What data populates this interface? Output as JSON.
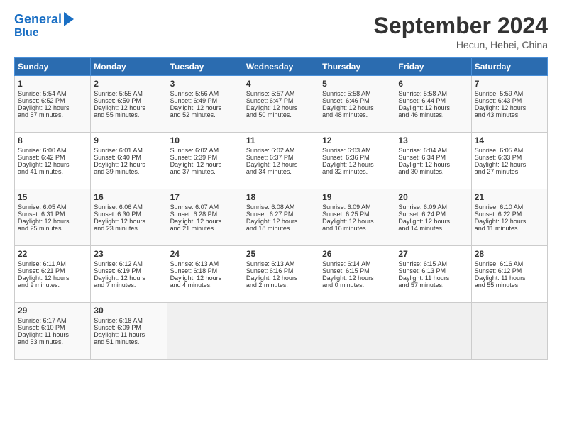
{
  "header": {
    "logo_line1": "General",
    "logo_line2": "Blue",
    "month": "September 2024",
    "location": "Hecun, Hebei, China"
  },
  "days_of_week": [
    "Sunday",
    "Monday",
    "Tuesday",
    "Wednesday",
    "Thursday",
    "Friday",
    "Saturday"
  ],
  "weeks": [
    [
      {
        "day": "1",
        "info": "Sunrise: 5:54 AM\nSunset: 6:52 PM\nDaylight: 12 hours\nand 57 minutes."
      },
      {
        "day": "2",
        "info": "Sunrise: 5:55 AM\nSunset: 6:50 PM\nDaylight: 12 hours\nand 55 minutes."
      },
      {
        "day": "3",
        "info": "Sunrise: 5:56 AM\nSunset: 6:49 PM\nDaylight: 12 hours\nand 52 minutes."
      },
      {
        "day": "4",
        "info": "Sunrise: 5:57 AM\nSunset: 6:47 PM\nDaylight: 12 hours\nand 50 minutes."
      },
      {
        "day": "5",
        "info": "Sunrise: 5:58 AM\nSunset: 6:46 PM\nDaylight: 12 hours\nand 48 minutes."
      },
      {
        "day": "6",
        "info": "Sunrise: 5:58 AM\nSunset: 6:44 PM\nDaylight: 12 hours\nand 46 minutes."
      },
      {
        "day": "7",
        "info": "Sunrise: 5:59 AM\nSunset: 6:43 PM\nDaylight: 12 hours\nand 43 minutes."
      }
    ],
    [
      {
        "day": "8",
        "info": "Sunrise: 6:00 AM\nSunset: 6:42 PM\nDaylight: 12 hours\nand 41 minutes."
      },
      {
        "day": "9",
        "info": "Sunrise: 6:01 AM\nSunset: 6:40 PM\nDaylight: 12 hours\nand 39 minutes."
      },
      {
        "day": "10",
        "info": "Sunrise: 6:02 AM\nSunset: 6:39 PM\nDaylight: 12 hours\nand 37 minutes."
      },
      {
        "day": "11",
        "info": "Sunrise: 6:02 AM\nSunset: 6:37 PM\nDaylight: 12 hours\nand 34 minutes."
      },
      {
        "day": "12",
        "info": "Sunrise: 6:03 AM\nSunset: 6:36 PM\nDaylight: 12 hours\nand 32 minutes."
      },
      {
        "day": "13",
        "info": "Sunrise: 6:04 AM\nSunset: 6:34 PM\nDaylight: 12 hours\nand 30 minutes."
      },
      {
        "day": "14",
        "info": "Sunrise: 6:05 AM\nSunset: 6:33 PM\nDaylight: 12 hours\nand 27 minutes."
      }
    ],
    [
      {
        "day": "15",
        "info": "Sunrise: 6:05 AM\nSunset: 6:31 PM\nDaylight: 12 hours\nand 25 minutes."
      },
      {
        "day": "16",
        "info": "Sunrise: 6:06 AM\nSunset: 6:30 PM\nDaylight: 12 hours\nand 23 minutes."
      },
      {
        "day": "17",
        "info": "Sunrise: 6:07 AM\nSunset: 6:28 PM\nDaylight: 12 hours\nand 21 minutes."
      },
      {
        "day": "18",
        "info": "Sunrise: 6:08 AM\nSunset: 6:27 PM\nDaylight: 12 hours\nand 18 minutes."
      },
      {
        "day": "19",
        "info": "Sunrise: 6:09 AM\nSunset: 6:25 PM\nDaylight: 12 hours\nand 16 minutes."
      },
      {
        "day": "20",
        "info": "Sunrise: 6:09 AM\nSunset: 6:24 PM\nDaylight: 12 hours\nand 14 minutes."
      },
      {
        "day": "21",
        "info": "Sunrise: 6:10 AM\nSunset: 6:22 PM\nDaylight: 12 hours\nand 11 minutes."
      }
    ],
    [
      {
        "day": "22",
        "info": "Sunrise: 6:11 AM\nSunset: 6:21 PM\nDaylight: 12 hours\nand 9 minutes."
      },
      {
        "day": "23",
        "info": "Sunrise: 6:12 AM\nSunset: 6:19 PM\nDaylight: 12 hours\nand 7 minutes."
      },
      {
        "day": "24",
        "info": "Sunrise: 6:13 AM\nSunset: 6:18 PM\nDaylight: 12 hours\nand 4 minutes."
      },
      {
        "day": "25",
        "info": "Sunrise: 6:13 AM\nSunset: 6:16 PM\nDaylight: 12 hours\nand 2 minutes."
      },
      {
        "day": "26",
        "info": "Sunrise: 6:14 AM\nSunset: 6:15 PM\nDaylight: 12 hours\nand 0 minutes."
      },
      {
        "day": "27",
        "info": "Sunrise: 6:15 AM\nSunset: 6:13 PM\nDaylight: 11 hours\nand 57 minutes."
      },
      {
        "day": "28",
        "info": "Sunrise: 6:16 AM\nSunset: 6:12 PM\nDaylight: 11 hours\nand 55 minutes."
      }
    ],
    [
      {
        "day": "29",
        "info": "Sunrise: 6:17 AM\nSunset: 6:10 PM\nDaylight: 11 hours\nand 53 minutes."
      },
      {
        "day": "30",
        "info": "Sunrise: 6:18 AM\nSunset: 6:09 PM\nDaylight: 11 hours\nand 51 minutes."
      },
      {
        "day": "",
        "info": ""
      },
      {
        "day": "",
        "info": ""
      },
      {
        "day": "",
        "info": ""
      },
      {
        "day": "",
        "info": ""
      },
      {
        "day": "",
        "info": ""
      }
    ]
  ]
}
